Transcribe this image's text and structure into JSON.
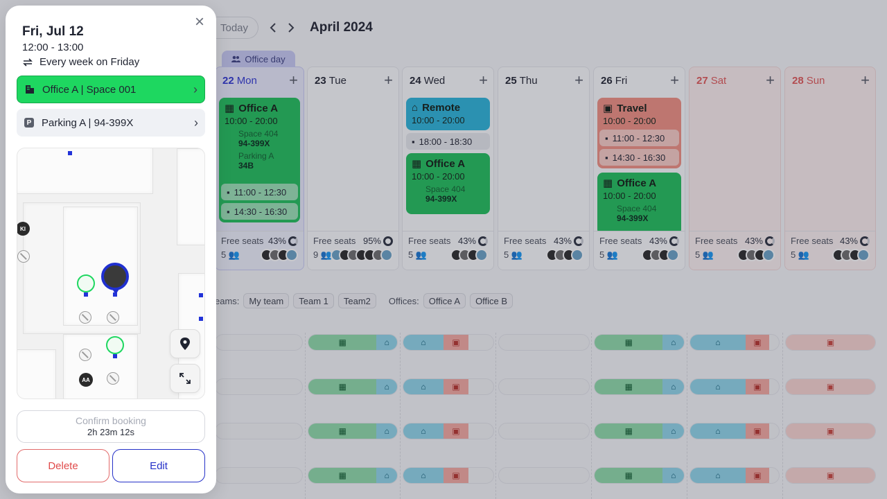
{
  "calendar": {
    "today_label": "Today",
    "prev_label": "‹",
    "next_label": "›",
    "month_title": "April 2024",
    "office_day_tag": "Office day",
    "days": [
      {
        "num": "22",
        "name": "Mon",
        "pct": "43%",
        "free_seats_label": "Free seats",
        "count": "5"
      },
      {
        "num": "23",
        "name": "Tue",
        "pct": "95%",
        "free_seats_label": "Free seats",
        "count": "9"
      },
      {
        "num": "24",
        "name": "Wed",
        "pct": "43%",
        "free_seats_label": "Free seats",
        "count": "5"
      },
      {
        "num": "25",
        "name": "Thu",
        "pct": "43%",
        "free_seats_label": "Free seats",
        "count": "5"
      },
      {
        "num": "26",
        "name": "Fri",
        "pct": "43%",
        "free_seats_label": "Free seats",
        "count": "5"
      },
      {
        "num": "27",
        "name": "Sat",
        "pct": "43%",
        "free_seats_label": "Free seats",
        "count": "5"
      },
      {
        "num": "28",
        "name": "Sun",
        "pct": "43%",
        "free_seats_label": "Free seats",
        "count": "5"
      }
    ],
    "events": {
      "mon_office": {
        "title": "Office A",
        "time": "10:00 - 20:00",
        "space": "Space 404",
        "space_code": "94-399X",
        "parking": "Parking A",
        "parking_code": "34B"
      },
      "mon_meet1": "11:00 - 12:30",
      "mon_meet2": "14:30 - 16:30",
      "wed_remote": {
        "title": "Remote",
        "time": "10:00 - 20:00"
      },
      "wed_meet": "18:00 - 18:30",
      "wed_office": {
        "title": "Office A",
        "time": "10:00 - 20:00",
        "space": "Space 404",
        "space_code": "94-399X"
      },
      "fri_travel": {
        "title": "Travel",
        "time": "10:00 - 20:00"
      },
      "fri_meet1": "11:00 - 12:30",
      "fri_meet2": "14:30 - 16:30",
      "fri_office": {
        "title": "Office A",
        "time": "10:00 - 20:00",
        "space": "Space 404",
        "space_code": "94-399X"
      }
    },
    "filters": {
      "teams_label": "eams:",
      "teams": [
        "My team",
        "Team 1",
        "Team2"
      ],
      "offices_label": "Offices:",
      "offices": [
        "Office A",
        "Office B"
      ]
    }
  },
  "panel": {
    "date": "Fri, Jul 12",
    "time": "12:00 - 13:00",
    "repeat": "Every week on Friday",
    "space_item": "Office A | Space 001",
    "parking_item": "Parking A | 94-399X",
    "parking_badge": "P",
    "map_initials_1": "KI",
    "map_initials_2": "AA",
    "confirm_label": "Confirm booking",
    "confirm_timer": "2h 23m 12s",
    "delete_label": "Delete",
    "edit_label": "Edit",
    "close_icon": "×"
  },
  "colors": {
    "office": "#1fbf5b",
    "remote": "#2ab4d9",
    "travel": "#f08f82",
    "accent": "#2430c8",
    "danger": "#e04a4a"
  }
}
